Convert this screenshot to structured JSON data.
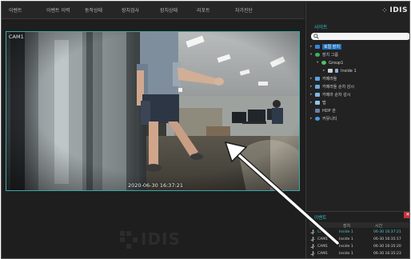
{
  "menu": {
    "items": [
      "이벤트",
      "이벤트 이력",
      "동작상태",
      "장치검사",
      "장치상태",
      "리포트",
      "자가진단"
    ]
  },
  "camera": {
    "label": "CAM1",
    "timestamp": "2020-06-30 16:37:21"
  },
  "watermark": {
    "text": "IDIS"
  },
  "brand": {
    "text": "IDIS"
  },
  "site_panel": {
    "title": "사이트",
    "search_placeholder": "",
    "tree": [
      {
        "label": "로컬 장치",
        "selected": true
      },
      {
        "label": "장치 그룹"
      },
      {
        "label": "Group1"
      },
      {
        "label": "Inside 1"
      },
      {
        "label": "카메라들"
      },
      {
        "label": "카메라들 순차 감시"
      },
      {
        "label": "카메라 순차 감시"
      },
      {
        "label": "맵"
      },
      {
        "label": "HDP 관"
      },
      {
        "label": "커뮤니티"
      }
    ]
  },
  "event_panel": {
    "title": "이벤트",
    "close_label": "✕",
    "columns": [
      "",
      "장치",
      "시간"
    ],
    "rows": [
      {
        "camera": "CAM1",
        "device": "Inside 1",
        "time": "06-30 16:37:21",
        "highlight": true
      },
      {
        "camera": "CAM1",
        "device": "Inside 1",
        "time": "06-30 16:35:17"
      },
      {
        "camera": "CAM1",
        "device": "Inside 1",
        "time": "06-30 16:35:20"
      },
      {
        "camera": "CAM1",
        "device": "Inside 1",
        "time": "06-30 16:35:23"
      }
    ]
  },
  "colors": {
    "accent": "#2fc3cf",
    "selection": "#1e6fb5",
    "alert": "#c8313a",
    "tile_border": "#3ea7a7"
  }
}
